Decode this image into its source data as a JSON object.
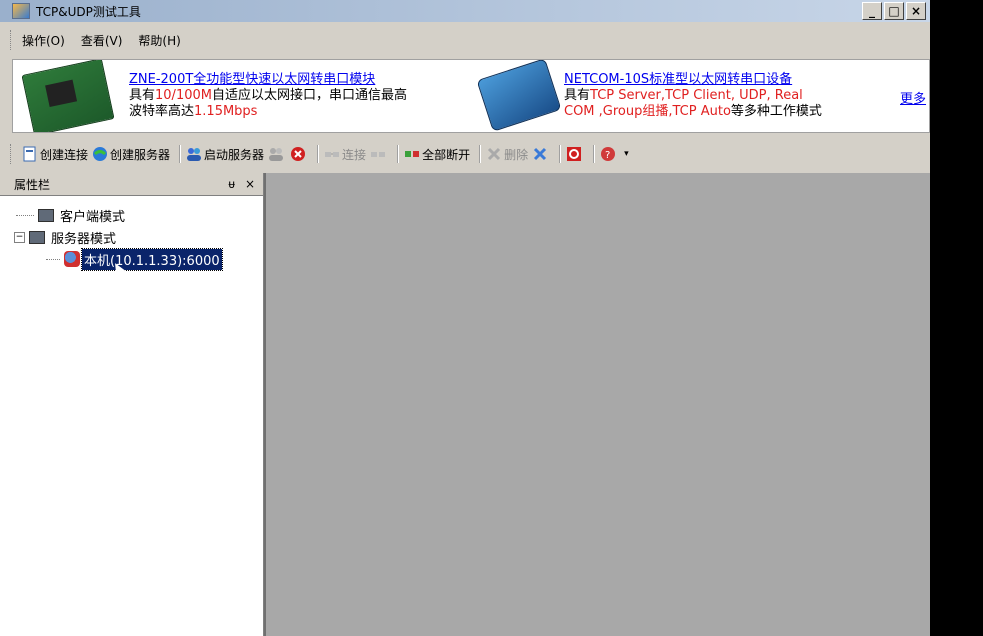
{
  "window": {
    "title": "TCP&UDP测试工具"
  },
  "menu": [
    "操作(O)",
    "查看(V)",
    "帮助(H)"
  ],
  "banner": {
    "ad1": {
      "link": "ZNE-200T全功能型快速以太网转串口模块",
      "t1": "具有",
      "t1_red": "10/100M",
      "t2": "自适应以太网接口，串口通信最高",
      "t3": "波特率高达",
      "t3_red": "1.15Mbps"
    },
    "ad2": {
      "link": "NETCOM-10S标准型以太网转串口设备",
      "t1": "具有",
      "t1_red": "TCP Server,TCP Client, UDP, Real",
      "t2_red": "COM ,Group组播,TCP Auto",
      "t2": "等多种工作模式"
    },
    "more": "更多"
  },
  "toolbar": {
    "create_conn": "创建连接",
    "create_server": "创建服务器",
    "start_server": "启动服务器",
    "connect": "连接",
    "disconnect_all": "全部断开",
    "delete": "删除"
  },
  "panel": {
    "title": "属性栏",
    "pin": "ᵾ",
    "close": "×",
    "client_mode": "客户端模式",
    "server_mode": "服务器模式",
    "server_item": "本机(10.1.1.33):6000"
  },
  "colors": {
    "titlebar": "#9ab0cc",
    "workarea": "#a8a8a8",
    "selection": "#0a246a"
  }
}
